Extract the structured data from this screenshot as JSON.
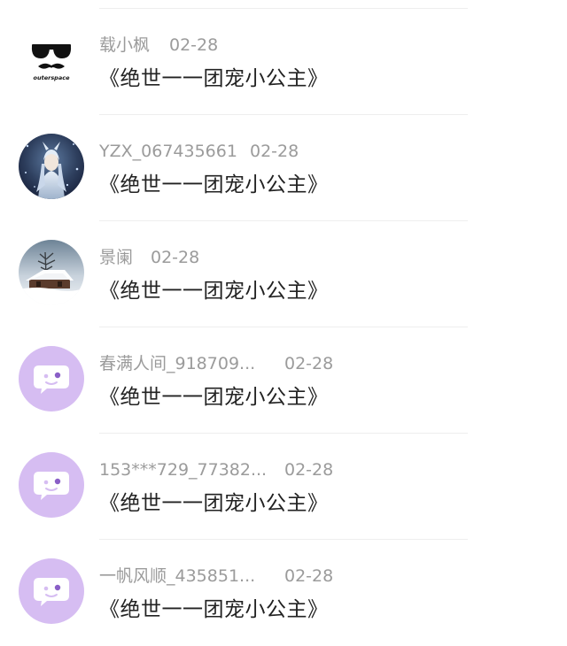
{
  "comments": [
    {
      "user": "载小枫",
      "date": "02-28",
      "text": "《绝世一一团宠小公主》",
      "avatar": "sunglasses-mustache-logo",
      "avatar_caption": "outerspace"
    },
    {
      "user": "YZX_067435661",
      "date": "02-28",
      "text": "《绝世一一团宠小公主》",
      "avatar": "anime-character-photo"
    },
    {
      "user": "景阑",
      "date": "02-28",
      "text": "《绝世一一团宠小公主》",
      "avatar": "snowy-house-photo"
    },
    {
      "user": "春满人间_918709...",
      "date": "02-28",
      "text": "《绝世一一团宠小公主》",
      "avatar": "default-chat-bubble-avatar"
    },
    {
      "user": "153***729_77382...",
      "date": "02-28",
      "text": "《绝世一一团宠小公主》",
      "avatar": "default-chat-bubble-avatar"
    },
    {
      "user": "一帆风顺_435851...",
      "date": "02-28",
      "text": "《绝世一一团宠小公主》",
      "avatar": "default-chat-bubble-avatar"
    }
  ],
  "colors": {
    "default_avatar_bg": "#d6bdf2",
    "username": "#9b9b9b",
    "content": "#222222",
    "divider": "#eeeeee"
  }
}
